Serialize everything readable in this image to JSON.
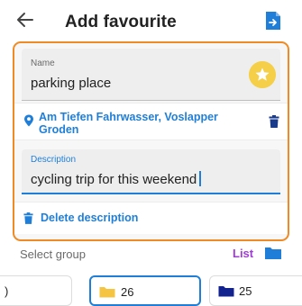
{
  "header": {
    "title": "Add favourite",
    "back_icon": "arrow-left-icon",
    "import_icon": "import-file-icon"
  },
  "form": {
    "name": {
      "label": "Name",
      "value": "parking place",
      "icon": "star-icon"
    },
    "address": {
      "text": "Am Tiefen Fahrwasser, Voslapper Groden",
      "icon": "location-pin-icon",
      "delete_icon": "trash-icon"
    },
    "description": {
      "label": "Description",
      "value": "cycling trip for this weekend"
    },
    "delete_description": {
      "label": "Delete description",
      "icon": "trash-icon"
    }
  },
  "group": {
    "select_label": "Select group",
    "list_label": "List",
    "list_icon": "folder-icon",
    "items": [
      {
        "label": ")",
        "color": "#ffffff"
      },
      {
        "label": "26",
        "color": "#f5c542",
        "selected": true
      },
      {
        "label": "25",
        "color": "#12228f"
      }
    ]
  },
  "colors": {
    "accent": "#1f7fd8",
    "highlight_border": "#f08a24",
    "star_badge": "#f5cf48",
    "list_link": "#a03cd6"
  }
}
